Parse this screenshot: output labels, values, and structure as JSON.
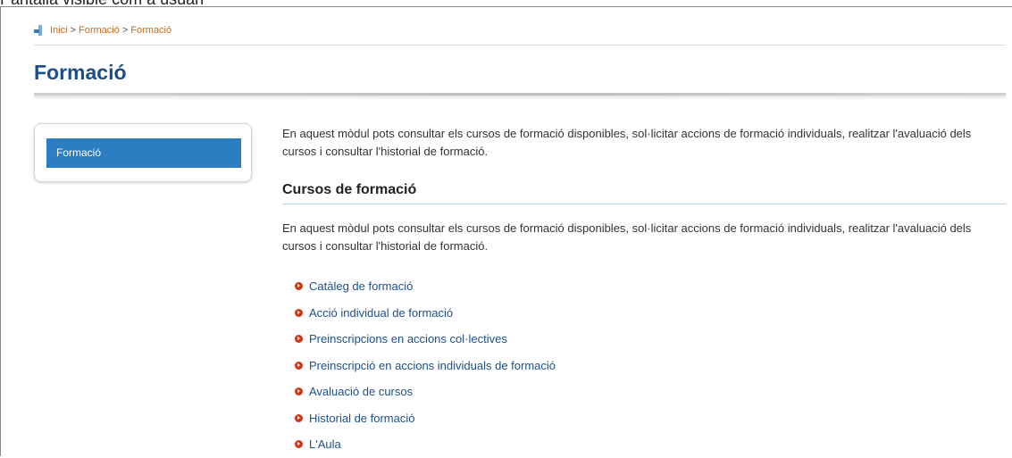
{
  "caption": "Pantalla visible com a usuari",
  "breadcrumb": {
    "home": "Inici",
    "items": [
      "Formació",
      "Formació"
    ],
    "separator": ">"
  },
  "page_title": "Formació",
  "sidebar": {
    "items": [
      {
        "label": "Formació",
        "active": true
      }
    ]
  },
  "main": {
    "intro": "En aquest mòdul pots consultar els cursos de formació disponibles, sol·licitar accions de formació individuals, realitzar l'avaluació dels cursos i consultar l'historial de formació.",
    "section": {
      "heading": "Cursos de formació",
      "text": "En aquest mòdul pots consultar els cursos de formació disponibles, sol·licitar accions de formació individuals, realitzar l'avaluació dels cursos i consultar l'historial de formació.",
      "links": [
        "Catàleg de formació",
        "Acció individual de formació",
        "Preinscripcions en accions col·lectives",
        "Preinscripció en accions individuals de formació",
        "Avaluació de cursos",
        "Historial de formació",
        "L'Aula"
      ]
    }
  },
  "colors": {
    "accent": "#2b7ec1",
    "title": "#1b4f8a",
    "breadcrumb_link": "#c06a1e",
    "link": "#1d4f8c",
    "bullet": "#c93a1b"
  }
}
